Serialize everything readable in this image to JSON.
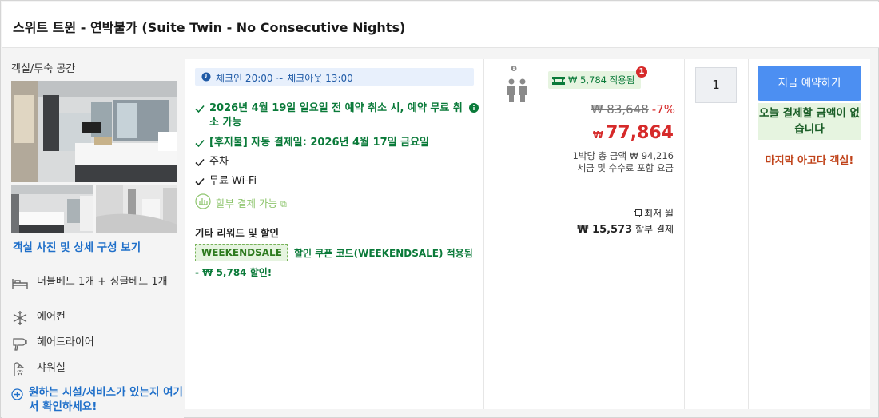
{
  "room": {
    "title": "스위트 트윈 - 연박불가 (Suite Twin - No Consecutive Nights)"
  },
  "left": {
    "section_title": "객실/투숙 공간",
    "photos_link": "객실 사진 및 상세 구성 보기",
    "amenities": [
      {
        "icon": "bed-icon",
        "label": "더블베드 1개 + 싱글베드 1개"
      },
      {
        "icon": "snowflake-icon",
        "label": "에어컨"
      },
      {
        "icon": "hairdryer-icon",
        "label": "헤어드라이어"
      },
      {
        "icon": "shower-icon",
        "label": "샤워실"
      }
    ],
    "more_link": "원하는 시설/서비스가 있는지 여기서 확인하세요!"
  },
  "offer": {
    "checkin": "체크인 20:00 ~ 체크아웃 13:00",
    "features": [
      {
        "text": "2026년 4월 19일 일요일 전 예약 취소 시, 예약 무료 취소 가능",
        "style": "green"
      },
      {
        "text": "[후지불] 자동 결제일: 2026년 4월 17일 금요일",
        "style": "green"
      },
      {
        "text": "주차",
        "style": "plain"
      },
      {
        "text": "무료 Wi-Fi",
        "style": "plain"
      }
    ],
    "installment": "할부 결제 가능",
    "promo_heading": "기타 리워드 및 할인",
    "coupon_code": "WEEKENDSALE",
    "coupon_text": "할인 쿠폰 코드(WEEKENDSALE) 적용됨",
    "coupon_discount": "- ₩ 5,784 할인!"
  },
  "price": {
    "savings_label": "₩ 5,784 적용됨",
    "badge_count": "1",
    "original": "₩ 83,648",
    "discount_pct": "-7%",
    "currency": "₩",
    "current": "77,864",
    "per_night": "1박당 총 금액 ₩ 94,216",
    "taxes_note": "세금 및 수수료 포함 요금",
    "lowest_label": "최저 월",
    "monthly_amount": "₩ 15,573",
    "monthly_suffix": "할부 결제"
  },
  "booking": {
    "quantity": "1",
    "book_button": "지금 예약하기",
    "no_pay_today": "오늘 결제할 금액이 없습니다",
    "last_room": "마지막 아고다 객실!"
  },
  "colors": {
    "accent_blue": "#4c8ff2",
    "link_blue": "#1f6fc9",
    "green": "#0a7a39",
    "red": "#d62a2a",
    "orange": "#c0431a"
  }
}
